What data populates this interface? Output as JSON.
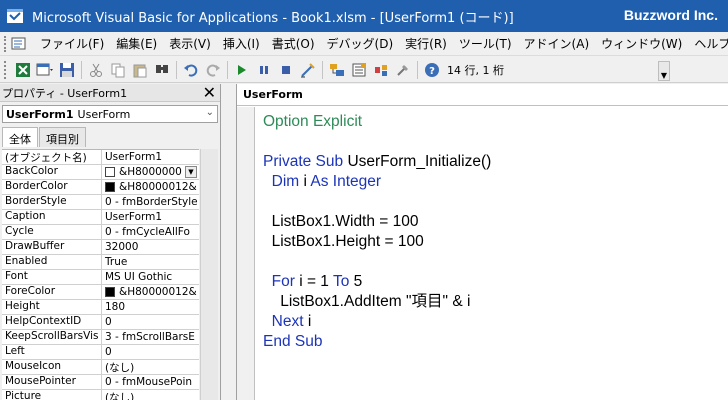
{
  "title_bar": {
    "title": "Microsoft Visual Basic for Applications - Book1.xlsm - [UserForm1 (コード)]",
    "brand": "Buzzword Inc."
  },
  "menu": {
    "items": [
      "ファイル(F)",
      "編集(E)",
      "表示(V)",
      "挿入(I)",
      "書式(O)",
      "デバッグ(D)",
      "実行(R)",
      "ツール(T)",
      "アドイン(A)",
      "ウィンドウ(W)",
      "ヘルプ(H)"
    ]
  },
  "toolbar": {
    "position": "14 行, 1 桁"
  },
  "properties": {
    "title": "プロパティ - UserForm1",
    "object_name": "UserForm1",
    "object_type": "UserForm",
    "tabs": [
      "全体",
      "項目別"
    ],
    "rows": [
      {
        "key": "(オブジェクト名)",
        "value": "UserForm1"
      },
      {
        "key": "BackColor",
        "value": "&H8000000",
        "swatch": "#ffffff",
        "dropdown": true
      },
      {
        "key": "BorderColor",
        "value": "&H80000012&",
        "swatch": "#000000"
      },
      {
        "key": "BorderStyle",
        "value": "0 - fmBorderStyle"
      },
      {
        "key": "Caption",
        "value": "UserForm1"
      },
      {
        "key": "Cycle",
        "value": "0 - fmCycleAllFo"
      },
      {
        "key": "DrawBuffer",
        "value": "32000"
      },
      {
        "key": "Enabled",
        "value": "True"
      },
      {
        "key": "Font",
        "value": "MS UI Gothic"
      },
      {
        "key": "ForeColor",
        "value": "&H80000012&",
        "swatch": "#000000"
      },
      {
        "key": "Height",
        "value": "180"
      },
      {
        "key": "HelpContextID",
        "value": "0"
      },
      {
        "key": "KeepScrollBarsVis",
        "value": "3 - fmScrollBarsE"
      },
      {
        "key": "Left",
        "value": "0"
      },
      {
        "key": "MouseIcon",
        "value": "(なし)"
      },
      {
        "key": "MousePointer",
        "value": "0 - fmMousePoin"
      },
      {
        "key": "Picture",
        "value": "(なし)"
      }
    ]
  },
  "code_window": {
    "object": "UserForm",
    "lines": [
      [
        {
          "t": "Option Explicit",
          "c": "cm"
        }
      ],
      [],
      [
        {
          "t": "Private Sub ",
          "c": "kw"
        },
        {
          "t": "UserForm_Initialize()",
          "c": ""
        }
      ],
      [
        {
          "t": "  ",
          "c": ""
        },
        {
          "t": "Dim ",
          "c": "kw"
        },
        {
          "t": "i ",
          "c": ""
        },
        {
          "t": "As Integer",
          "c": "kw"
        }
      ],
      [],
      [
        {
          "t": "  ListBox1.Width = 100",
          "c": ""
        }
      ],
      [
        {
          "t": "  ListBox1.Height = 100",
          "c": ""
        }
      ],
      [],
      [
        {
          "t": "  ",
          "c": ""
        },
        {
          "t": "For ",
          "c": "kw"
        },
        {
          "t": "i = 1 ",
          "c": ""
        },
        {
          "t": "To ",
          "c": "kw"
        },
        {
          "t": "5",
          "c": ""
        }
      ],
      [
        {
          "t": "    ListBox1.AddItem \"項目\" & i",
          "c": ""
        }
      ],
      [
        {
          "t": "  ",
          "c": ""
        },
        {
          "t": "Next ",
          "c": "kw"
        },
        {
          "t": "i",
          "c": ""
        }
      ],
      [
        {
          "t": "End Sub",
          "c": "kw"
        }
      ]
    ]
  },
  "colors": {
    "title_bar": "#1f5fae",
    "keyword": "#1c34b8",
    "comment": "#2e8b57"
  }
}
